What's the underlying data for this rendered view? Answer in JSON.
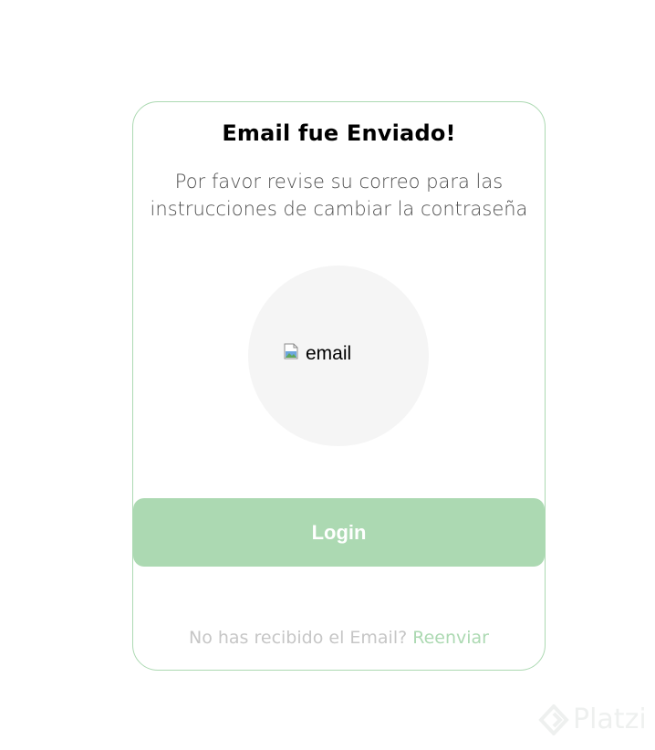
{
  "card": {
    "title": "Email fue Enviado!",
    "subtitle_line1": "Por favor revise su correo para las",
    "subtitle_line2": "instrucciones de cambiar la contraseña",
    "image_alt": "email",
    "login_label": "Login",
    "resend_prompt": "No has recibido el Email?",
    "resend_link": "Reenviar"
  },
  "watermark": {
    "text": "Platzi"
  },
  "colors": {
    "accent": "#acd9b2",
    "border": "#acd9b2",
    "circle_bg": "#f5f5f5",
    "muted_text": "#c6c6c6",
    "subtitle_text": "#4f4f4f"
  },
  "icons": {
    "broken_image": "broken-image-icon",
    "watermark_logo": "platzi-logo-icon"
  }
}
